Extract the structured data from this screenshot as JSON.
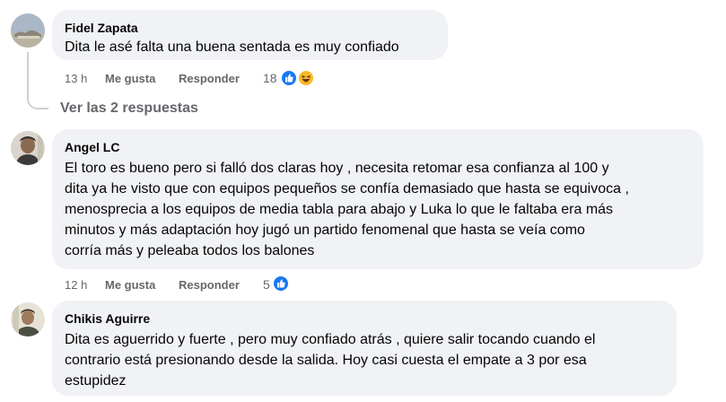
{
  "comments": [
    {
      "author": "Fidel Zapata",
      "lines": [
        "Dita le asé falta una buena sentada es muy confiado"
      ],
      "time": "13 h",
      "like_label": "Me gusta",
      "reply_label": "Responder",
      "reaction_count": "18",
      "reactions": [
        "like-icon",
        "haha-icon"
      ]
    },
    {
      "author": "Angel LC",
      "lines": [
        "El toro es bueno pero si falló dos claras hoy , necesita retomar esa confianza al 100 y",
        "dita ya he visto que con equipos pequeños se confía demasiado que hasta se equivoca ,",
        "menosprecia a los equipos de media tabla para abajo y Luka lo que le faltaba era más",
        "minutos y más adaptación hoy jugó un partido fenomenal que hasta se veía como",
        "corría más y peleaba todos los balones"
      ],
      "time": "12 h",
      "like_label": "Me gusta",
      "reply_label": "Responder",
      "reaction_count": "5",
      "reactions": [
        "like-icon"
      ]
    },
    {
      "author": "Chikis Aguirre",
      "lines": [
        "Dita es aguerrido y fuerte , pero muy confiado atrás , quiere salir tocando cuando el",
        "contrario está presionando desde la salida. Hoy casi cuesta el empate a 3 por esa",
        "estupidez"
      ]
    }
  ],
  "view_replies_label": "Ver las 2 respuestas",
  "colors": {
    "bubble": "#f0f2f5",
    "meta_text": "#65676b",
    "like_blue": "#1877f2",
    "haha_yellow": "#f7b928"
  }
}
